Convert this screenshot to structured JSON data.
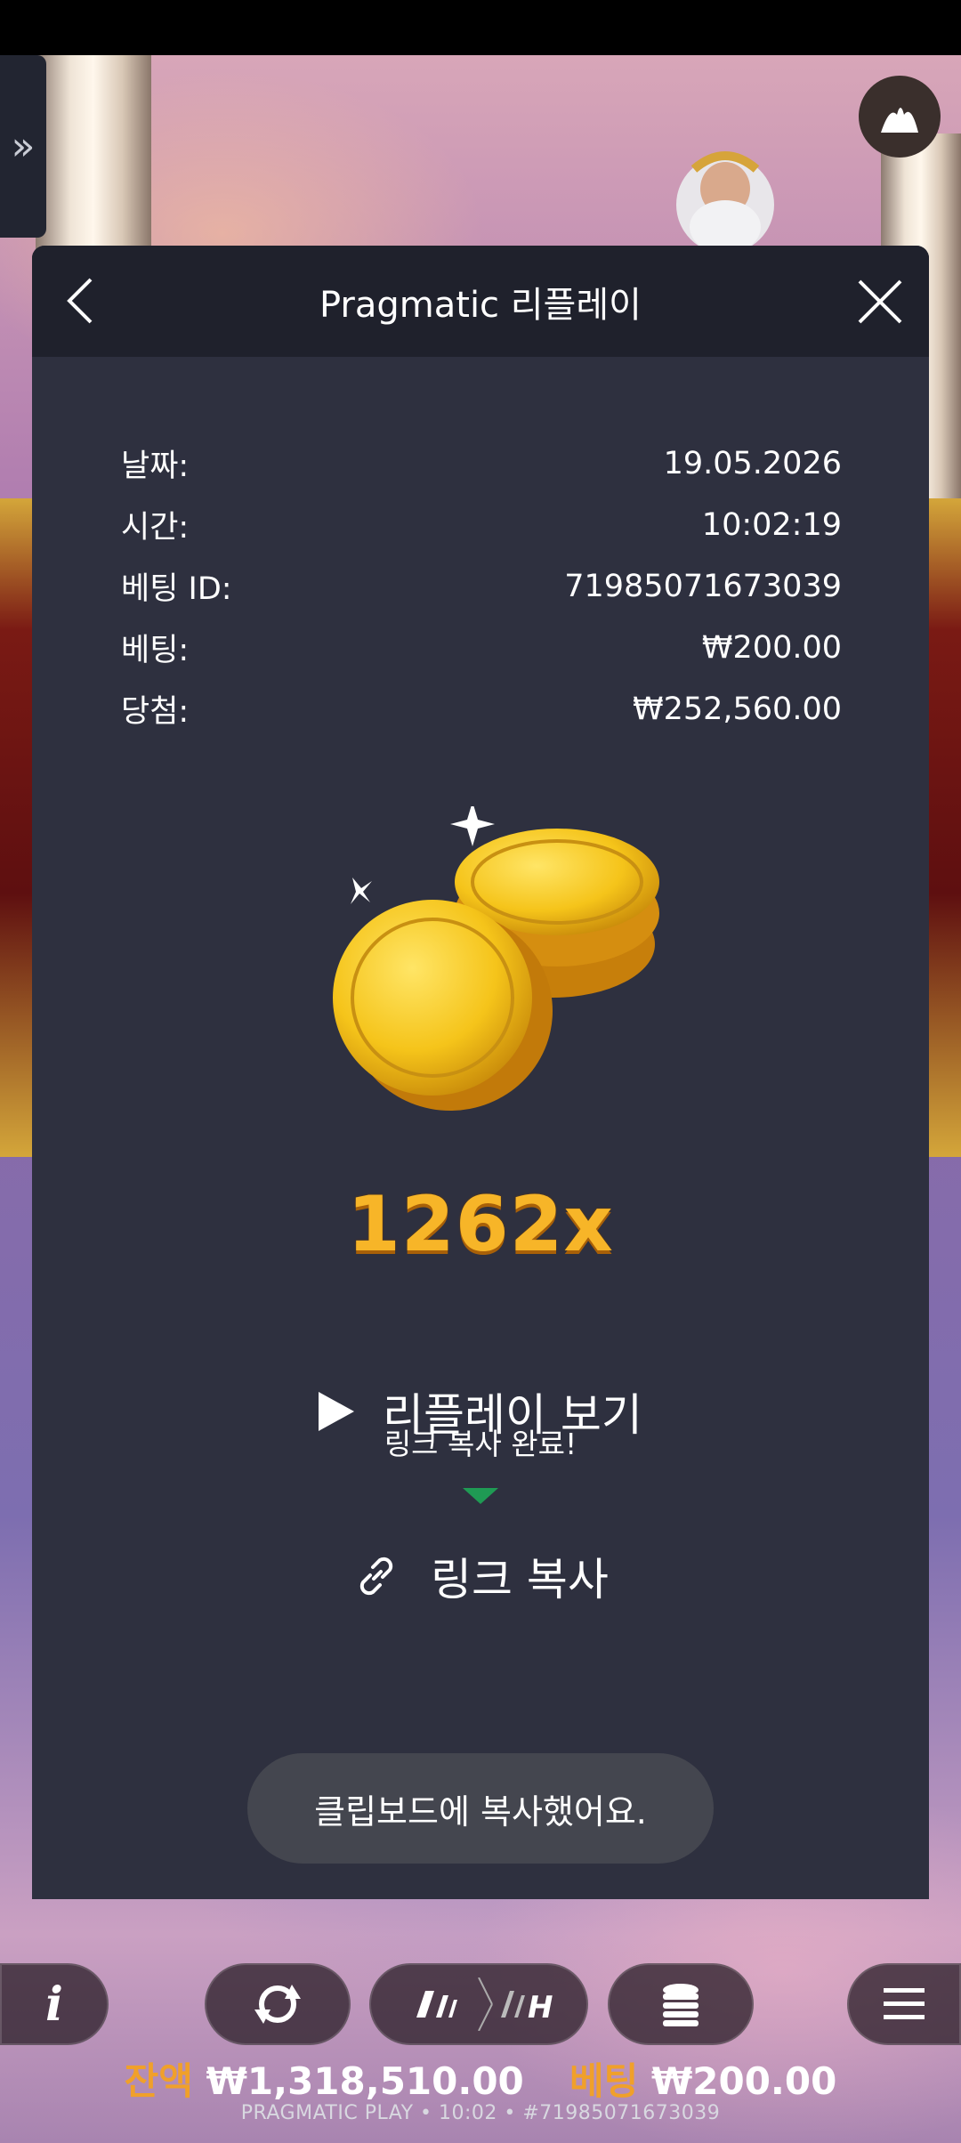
{
  "modal": {
    "title": "Pragmatic 리플레이",
    "info": [
      {
        "label": "날짜:",
        "value": "19.05.2026"
      },
      {
        "label": "시간:",
        "value": "10:02:19"
      },
      {
        "label": "베팅 ID:",
        "value": "71985071673039"
      },
      {
        "label": "베팅:",
        "value": "₩200.00"
      },
      {
        "label": "당첨:",
        "value": "₩252,560.00"
      }
    ],
    "multiplier": "1262x",
    "replay_label": "리플레이 보기",
    "tooltip": "링크 복사 완료!",
    "copy_label": "링크 복사",
    "toast": "클립보드에 복사했어요."
  },
  "bottom": {
    "balance_label": "잔액",
    "balance_value": "₩1,318,510.00",
    "bet_label": "베팅",
    "bet_value": "₩200.00",
    "footer": "PRAGMATIC PLAY • 10:02 • #71985071673039"
  },
  "colors": {
    "modal_bg": "#2e303f",
    "header_bg": "#1f212c",
    "accent_gold": "#f7b528",
    "tooltip_green": "#1f9a54",
    "balance_orange": "#f0a02a"
  }
}
